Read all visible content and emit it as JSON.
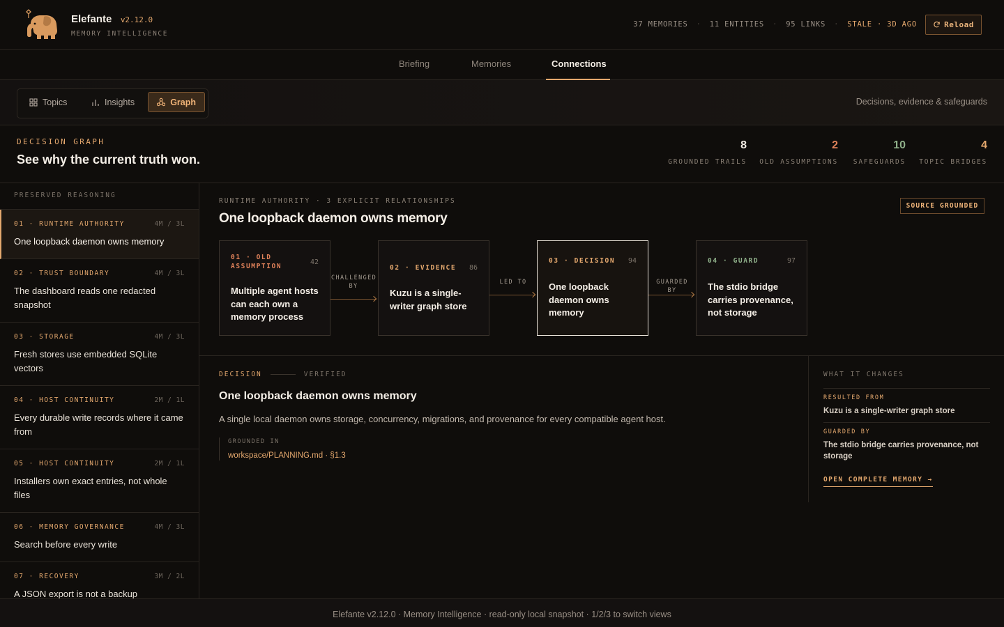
{
  "header": {
    "app_name": "Elefante",
    "version": "v2.12.0",
    "subtitle": "MEMORY INTELLIGENCE",
    "stats": {
      "memories": "37 MEMORIES",
      "entities": "11 ENTITIES",
      "links": "95 LINKS",
      "stale": "STALE · 3D AGO",
      "separator": "·"
    },
    "reload_label": "Reload",
    "reload_icon": "refresh-icon",
    "logo_icon": "elephant-logo"
  },
  "tabs": [
    {
      "label": "Briefing",
      "active": false
    },
    {
      "label": "Memories",
      "active": false
    },
    {
      "label": "Connections",
      "active": true
    }
  ],
  "subnav": {
    "items": [
      {
        "label": "Topics",
        "icon": "grid-icon",
        "active": false
      },
      {
        "label": "Insights",
        "icon": "bar-chart-icon",
        "active": false
      },
      {
        "label": "Graph",
        "icon": "graph-icon",
        "active": true
      }
    ],
    "right_text": "Decisions, evidence & safeguards"
  },
  "section": {
    "eyebrow": "DECISION GRAPH",
    "title": "See why the current truth won.",
    "metrics": [
      {
        "value": "8",
        "label": "GROUNDED TRAILS",
        "color": "#f4eee6"
      },
      {
        "value": "2",
        "label": "OLD ASSUMPTIONS",
        "color": "#e0825a"
      },
      {
        "value": "10",
        "label": "SAFEGUARDS",
        "color": "#8fb08a"
      },
      {
        "value": "4",
        "label": "TOPIC BRIDGES",
        "color": "#e4a86e"
      }
    ]
  },
  "sidebar": {
    "heading": "PRESERVED REASONING",
    "items": [
      {
        "category": "01 · RUNTIME AUTHORITY",
        "count": "4M / 3L",
        "title": "One loopback daemon owns memory",
        "active": true
      },
      {
        "category": "02 · TRUST BOUNDARY",
        "count": "4M / 3L",
        "title": "The dashboard reads one redacted snapshot",
        "active": false
      },
      {
        "category": "03 · STORAGE",
        "count": "4M / 3L",
        "title": "Fresh stores use embedded SQLite vectors",
        "active": false
      },
      {
        "category": "04 · HOST CONTINUITY",
        "count": "2M / 1L",
        "title": "Every durable write records where it came from",
        "active": false
      },
      {
        "category": "05 · HOST CONTINUITY",
        "count": "2M / 1L",
        "title": "Installers own exact entries, not whole files",
        "active": false
      },
      {
        "category": "06 · MEMORY GOVERNANCE",
        "count": "4M / 3L",
        "title": "Search before every write",
        "active": false
      },
      {
        "category": "07 · RECOVERY",
        "count": "3M / 2L",
        "title": "A JSON export is not a backup",
        "active": false
      }
    ]
  },
  "graph": {
    "eyebrow": "RUNTIME AUTHORITY · 3 EXPLICIT RELATIONSHIPS",
    "title": "One loopback daemon owns memory",
    "badge": "SOURCE GROUNDED",
    "nodes": [
      {
        "stage": "01 · OLD ASSUMPTION",
        "score": "42",
        "text": "Multiple agent hosts can each own a memory process",
        "color": "#e0825a"
      },
      {
        "stage": "02 · EVIDENCE",
        "score": "86",
        "text": "Kuzu is a single-writer graph store",
        "color": "#e4a86e"
      },
      {
        "stage": "03 · DECISION",
        "score": "94",
        "text": "One loopback daemon owns memory",
        "color": "#e4a86e"
      },
      {
        "stage": "04 · GUARD",
        "score": "97",
        "text": "The stdio bridge carries provenance, not storage",
        "color": "#8fb08a"
      }
    ],
    "edges": [
      {
        "label": "CHALLENGED BY"
      },
      {
        "label": "LED TO"
      },
      {
        "label": "GUARDED BY"
      }
    ]
  },
  "detail": {
    "tag": "DECISION",
    "status": "VERIFIED",
    "title": "One loopback daemon owns memory",
    "body": "A single local daemon owns storage, concurrency, migrations, and provenance for every compatible agent host.",
    "grounded_label": "GROUNDED IN",
    "grounded_link": "workspace/PLANNING.md · §1.3"
  },
  "changes": {
    "heading": "WHAT IT CHANGES",
    "resulted_label": "RESULTED FROM",
    "resulted_value": "Kuzu is a single-writer graph store",
    "guarded_label": "GUARDED BY",
    "guarded_value": "The stdio bridge carries provenance, not storage",
    "link": "OPEN COMPLETE MEMORY →"
  },
  "footer": {
    "text": "Elefante v2.12.0 · Memory Intelligence · read-only local snapshot · 1/2/3 to switch views"
  }
}
